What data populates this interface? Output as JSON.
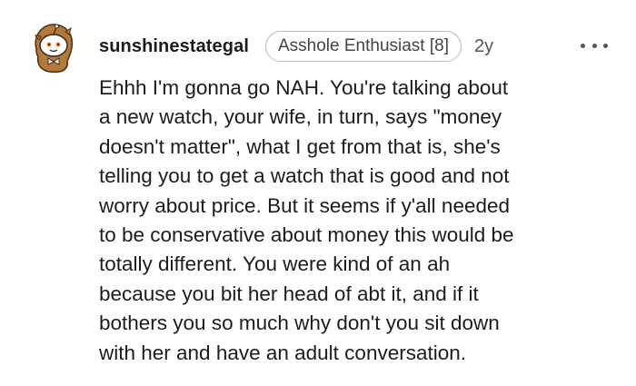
{
  "comment": {
    "author": "sunshinestategal",
    "flair": "Asshole Enthusiast [8]",
    "age": "2y",
    "avatar_icon": "snoo-avatar-icon",
    "more_icon": "more-options-icon",
    "body": "Ehhh I'm gonna go NAH. You're talking about\na new watch, your wife, in turn, says \"money\ndoesn't matter\", what I get from that is, she's\ntelling you to get a watch that is good and not\nworry about price. But it seems if y'all needed\nto be conservative about money this would be\ntotally different. You were kind of an ah\nbecause you bit her head of abt it, and if it\nbothers you so much why don't you sit down\nwith her and have an adult conversation."
  },
  "colors": {
    "text": "#1c1c1c",
    "meta": "#555555",
    "flair_border": "#b9b9b9",
    "avatar_fur": "#b5793a",
    "avatar_face": "#ffffff"
  }
}
